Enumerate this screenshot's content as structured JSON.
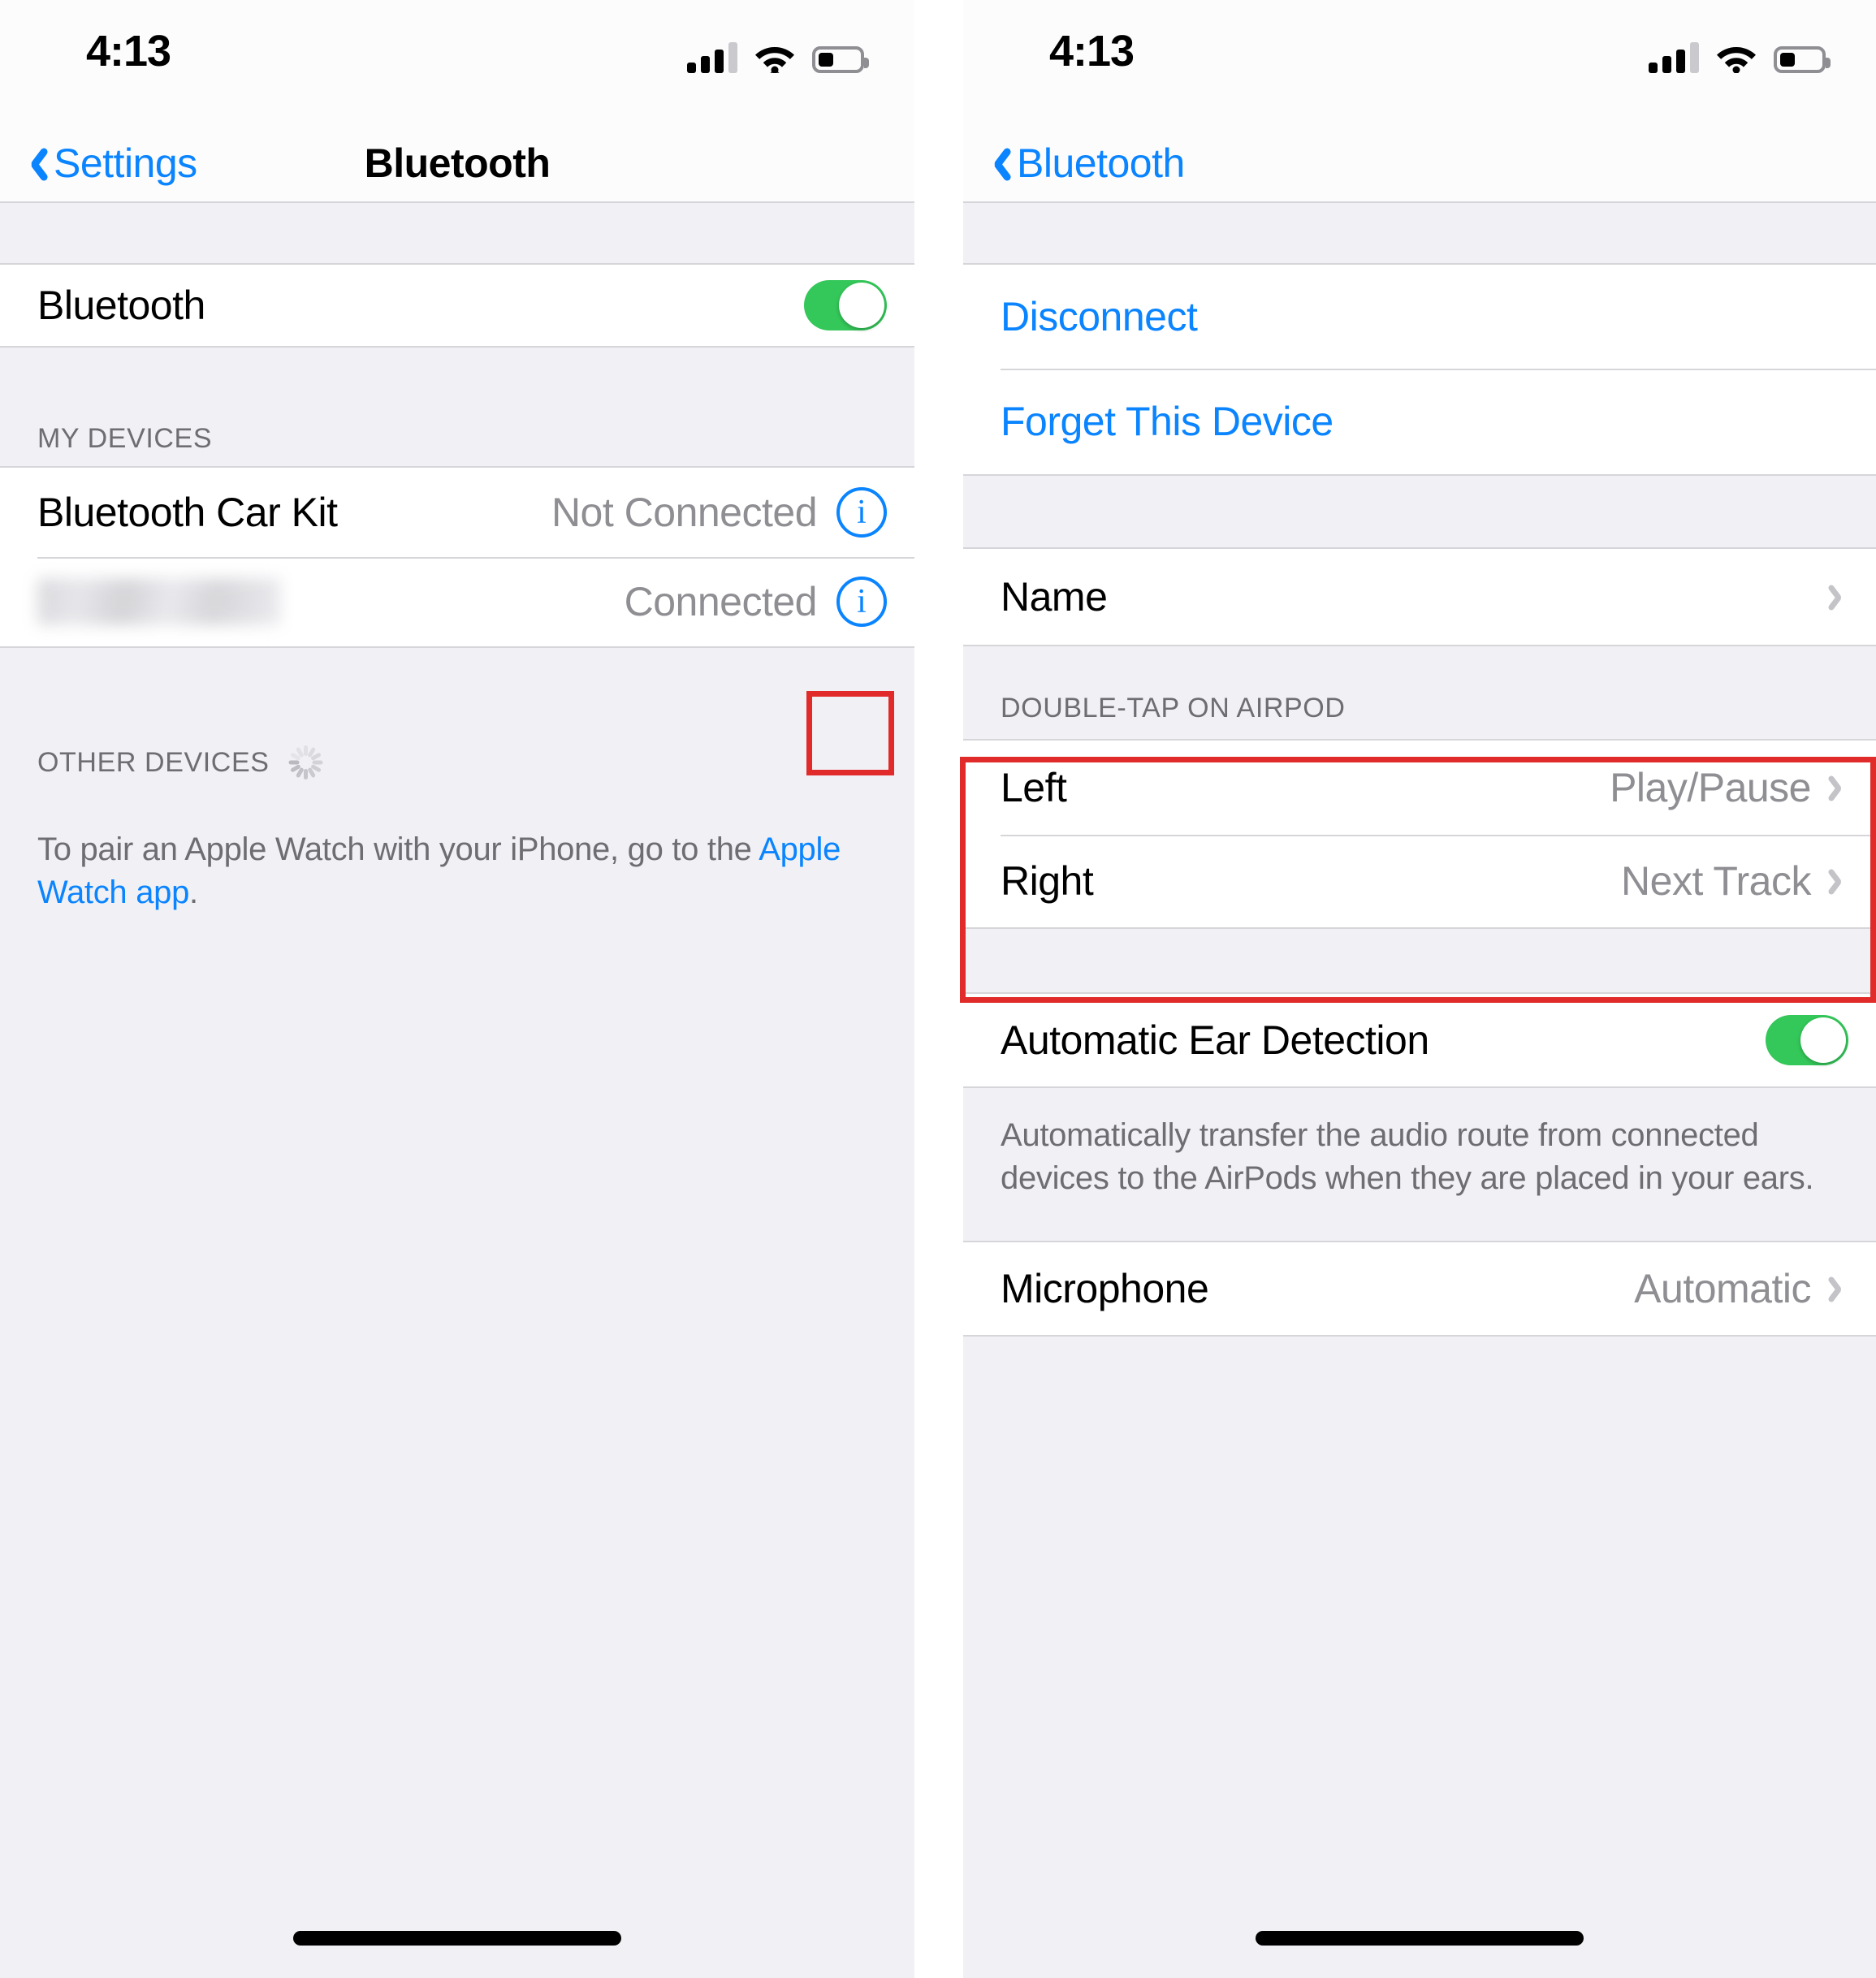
{
  "left": {
    "status": {
      "time": "4:13",
      "signal_icon": "cellular-bars-icon",
      "wifi_icon": "wifi-icon",
      "battery_icon": "battery-icon"
    },
    "nav": {
      "back_label": "Settings",
      "title": "Bluetooth"
    },
    "bluetooth_row": {
      "label": "Bluetooth",
      "toggle_state": "on"
    },
    "my_devices": {
      "header": "MY DEVICES",
      "items": [
        {
          "name": "Bluetooth Car Kit",
          "status": "Not Connected",
          "info_icon": "info-circle-icon",
          "highlighted": false
        },
        {
          "name": "",
          "status": "Connected",
          "info_icon": "info-circle-icon",
          "highlighted": true,
          "blurred": true
        }
      ]
    },
    "other_devices": {
      "header": "OTHER DEVICES",
      "spinner_icon": "loading-spinner-icon",
      "note_prefix": "To pair an Apple Watch with your iPhone, go to the ",
      "note_link": "Apple Watch app",
      "note_suffix": "."
    }
  },
  "right": {
    "status": {
      "time": "4:13",
      "signal_icon": "cellular-bars-icon",
      "wifi_icon": "wifi-icon",
      "battery_icon": "battery-icon"
    },
    "nav": {
      "back_label": "Bluetooth"
    },
    "actions": [
      {
        "label": "Disconnect"
      },
      {
        "label": "Forget This Device"
      }
    ],
    "name_row": {
      "label": "Name",
      "chevron_icon": "chevron-right-icon"
    },
    "double_tap": {
      "header": "DOUBLE-TAP ON AIRPOD",
      "rows": [
        {
          "label": "Left",
          "value": "Play/Pause",
          "chevron_icon": "chevron-right-icon"
        },
        {
          "label": "Right",
          "value": "Next Track",
          "chevron_icon": "chevron-right-icon"
        }
      ]
    },
    "ear_detection": {
      "label": "Automatic Ear Detection",
      "toggle_state": "on"
    },
    "ear_detection_note": "Automatically transfer the audio route from connected devices to the AirPods when they are placed in your ears.",
    "microphone_row": {
      "label": "Microphone",
      "value": "Automatic",
      "chevron_icon": "chevron-right-icon"
    }
  },
  "annotations": {
    "highlight_color": "#e12b2b",
    "boxes": [
      {
        "name": "info-icon-highlight"
      },
      {
        "name": "double-tap-section-highlight"
      }
    ]
  },
  "colors": {
    "accent_blue": "#0a84ff",
    "toggle_green": "#34c759",
    "group_bg": "#f1f1f5",
    "secondary_text": "#8e8e93"
  }
}
